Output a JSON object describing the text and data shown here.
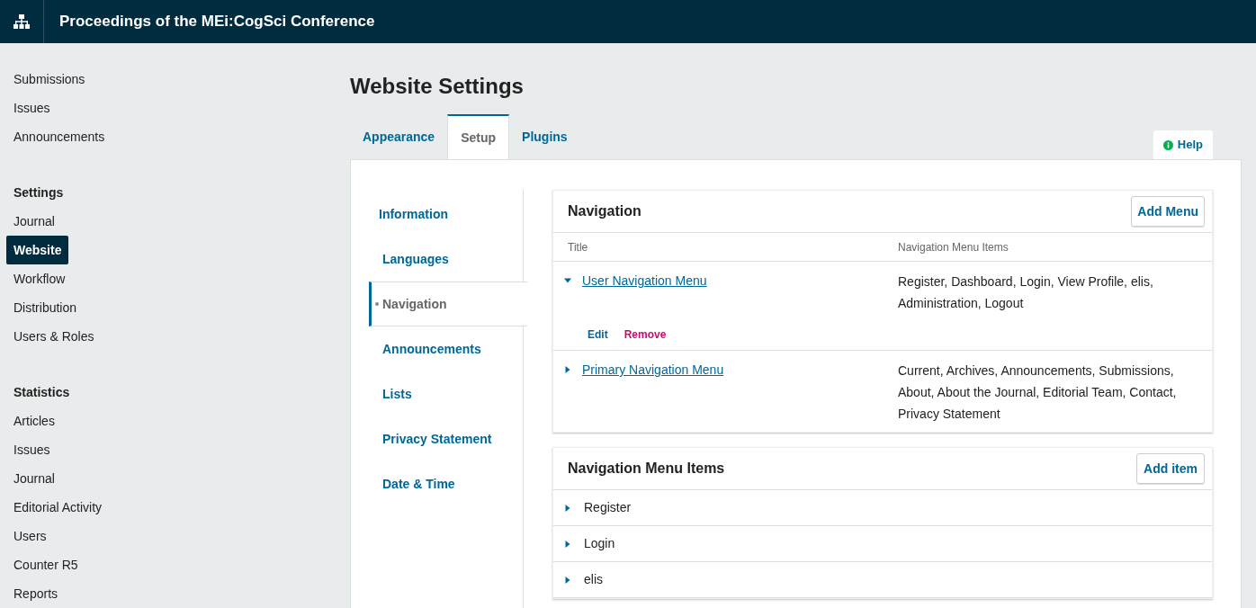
{
  "header": {
    "title": "Proceedings of the MEi:CogSci Conference"
  },
  "sidebar": {
    "sections": [
      {
        "items": [
          {
            "label": "Submissions",
            "selected": false
          },
          {
            "label": "Issues",
            "selected": false
          },
          {
            "label": "Announcements",
            "selected": false
          }
        ]
      },
      {
        "heading": "Settings",
        "items": [
          {
            "label": "Journal",
            "selected": false
          },
          {
            "label": "Website",
            "selected": true
          },
          {
            "label": "Workflow",
            "selected": false
          },
          {
            "label": "Distribution",
            "selected": false
          },
          {
            "label": "Users & Roles",
            "selected": false
          }
        ]
      },
      {
        "heading": "Statistics",
        "items": [
          {
            "label": "Articles",
            "selected": false
          },
          {
            "label": "Issues",
            "selected": false
          },
          {
            "label": "Journal",
            "selected": false
          },
          {
            "label": "Editorial Activity",
            "selected": false
          },
          {
            "label": "Users",
            "selected": false
          },
          {
            "label": "Counter R5",
            "selected": false
          },
          {
            "label": "Reports",
            "selected": false
          }
        ]
      }
    ]
  },
  "page_title": "Website Settings",
  "tabs": [
    {
      "label": "Appearance",
      "selected": false
    },
    {
      "label": "Setup",
      "selected": true
    },
    {
      "label": "Plugins",
      "selected": false
    }
  ],
  "help": {
    "label": "Help"
  },
  "settings_nav": [
    {
      "label": "Information",
      "selected": false
    },
    {
      "label": "Languages",
      "selected": false
    },
    {
      "label": "Navigation",
      "selected": true
    },
    {
      "label": "Announcements",
      "selected": false
    },
    {
      "label": "Lists",
      "selected": false
    },
    {
      "label": "Privacy Statement",
      "selected": false
    },
    {
      "label": "Date & Time",
      "selected": false
    }
  ],
  "navigation": {
    "title": "Navigation",
    "add_button": "Add Menu",
    "columns": [
      "Title",
      "Navigation Menu Items"
    ],
    "menus": [
      {
        "title": "User Navigation Menu",
        "items": "Register, Dashboard, Login, View Profile, elis, Administration, Logout",
        "expanded": true,
        "actions": [
          {
            "label": "Edit",
            "kind": "edit"
          },
          {
            "label": "Remove",
            "kind": "remove"
          }
        ]
      },
      {
        "title": "Primary Navigation Menu",
        "items": "Current, Archives, Announcements, Submissions, About, About the Journal, Editorial Team, Contact, Privacy Statement",
        "expanded": false
      }
    ]
  },
  "menu_items": {
    "title": "Navigation Menu Items",
    "add_button": "Add item",
    "items": [
      {
        "label": "Register",
        "expanded": false
      },
      {
        "label": "Login",
        "expanded": false
      },
      {
        "label": "elis",
        "expanded": false
      }
    ]
  }
}
